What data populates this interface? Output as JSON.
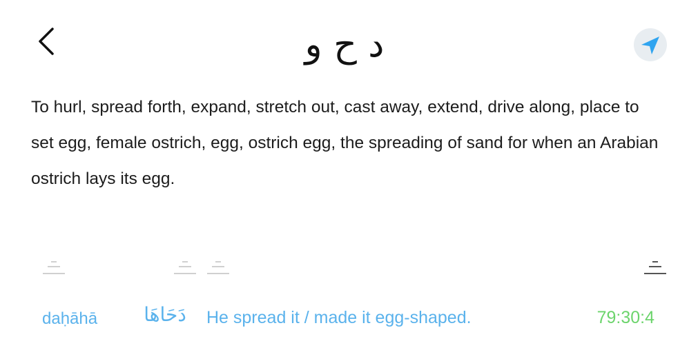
{
  "header": {
    "back_icon": "chevron-left-icon",
    "root_title": "د ح و",
    "nav_icon": "location-arrow-icon",
    "nav_bg_color": "#e8edf1",
    "nav_icon_color": "#2fa4f0"
  },
  "definition": {
    "text": "To hurl, spread forth, expand, stretch out, cast away, extend, drive along, place to set egg, female ostrich, egg, ostrich egg, the spreading of sand for when an Arabian ostrich lays its egg."
  },
  "markers": {
    "icon": "stacked-lines-icon",
    "inactive_color": "#d0d0d0",
    "active_color": "#555555"
  },
  "occurrence": {
    "transliteration": "daḥāhā",
    "arabic": "دَحَاهَا",
    "translation": "He spread it / made it egg-shaped.",
    "reference": "79:30:4",
    "text_color": "#5ab2ec",
    "reference_color": "#6cd46c"
  }
}
